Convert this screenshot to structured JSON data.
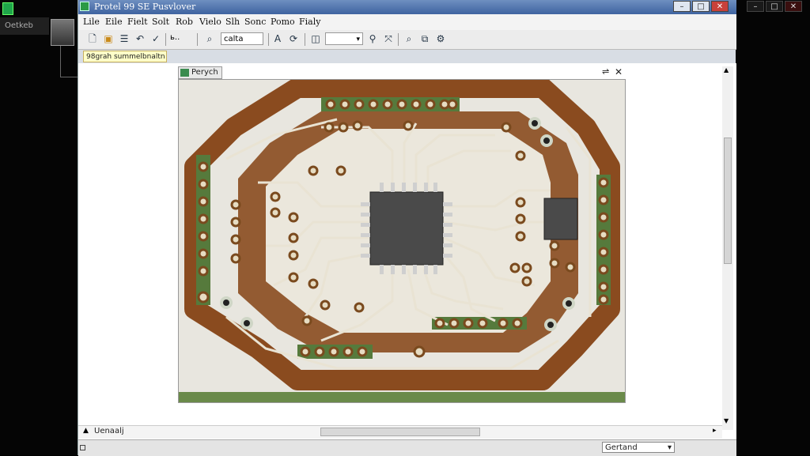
{
  "left_panel": {
    "tab_label": "Oetkeb"
  },
  "window": {
    "title": "Protel 99 SE Pusvlover",
    "controls": {
      "minimize": "–",
      "restore": "□",
      "close": "✕"
    }
  },
  "outer_controls": {
    "minimize": "–",
    "restore": "□",
    "close": "✕"
  },
  "menu": [
    "Lile",
    "Eile",
    "Fielt",
    "Solt",
    "Rob",
    "Vielo",
    "Slh",
    "Sonc",
    "Pomo",
    "Fialy"
  ],
  "toolbar": {
    "zoom_combo": "ь..",
    "font_combo": "calta",
    "layer_combo": "",
    "icons": [
      "new-file-icon",
      "open-folder-icon",
      "list-icon",
      "undo-icon",
      "check-icon",
      "zoom-icon",
      "text-a-icon",
      "rotate-icon",
      "pin-icon",
      "route-icon",
      "search-icon",
      "layer-icon",
      "drc-icon"
    ]
  },
  "tooltip": "98grah summelbnaltn",
  "document": {
    "tab_label": "Perych",
    "float_glyph": "⇌",
    "close_glyph": "✕"
  },
  "hscroll": {
    "label": "Uenaalj"
  },
  "status": {
    "field": "Gertand"
  },
  "colors": {
    "copper": "#8a4b1f",
    "board": "#e8e6df",
    "chip": "#4a4a4a",
    "pad": "#567a3c",
    "title_bar": "#3e63a0"
  },
  "pcb": {
    "ic_pins_per_side": 6,
    "top_header_pads": 11,
    "bottom_header_pads": 6,
    "left_header_pads": 8,
    "right_header_pads": 8
  }
}
